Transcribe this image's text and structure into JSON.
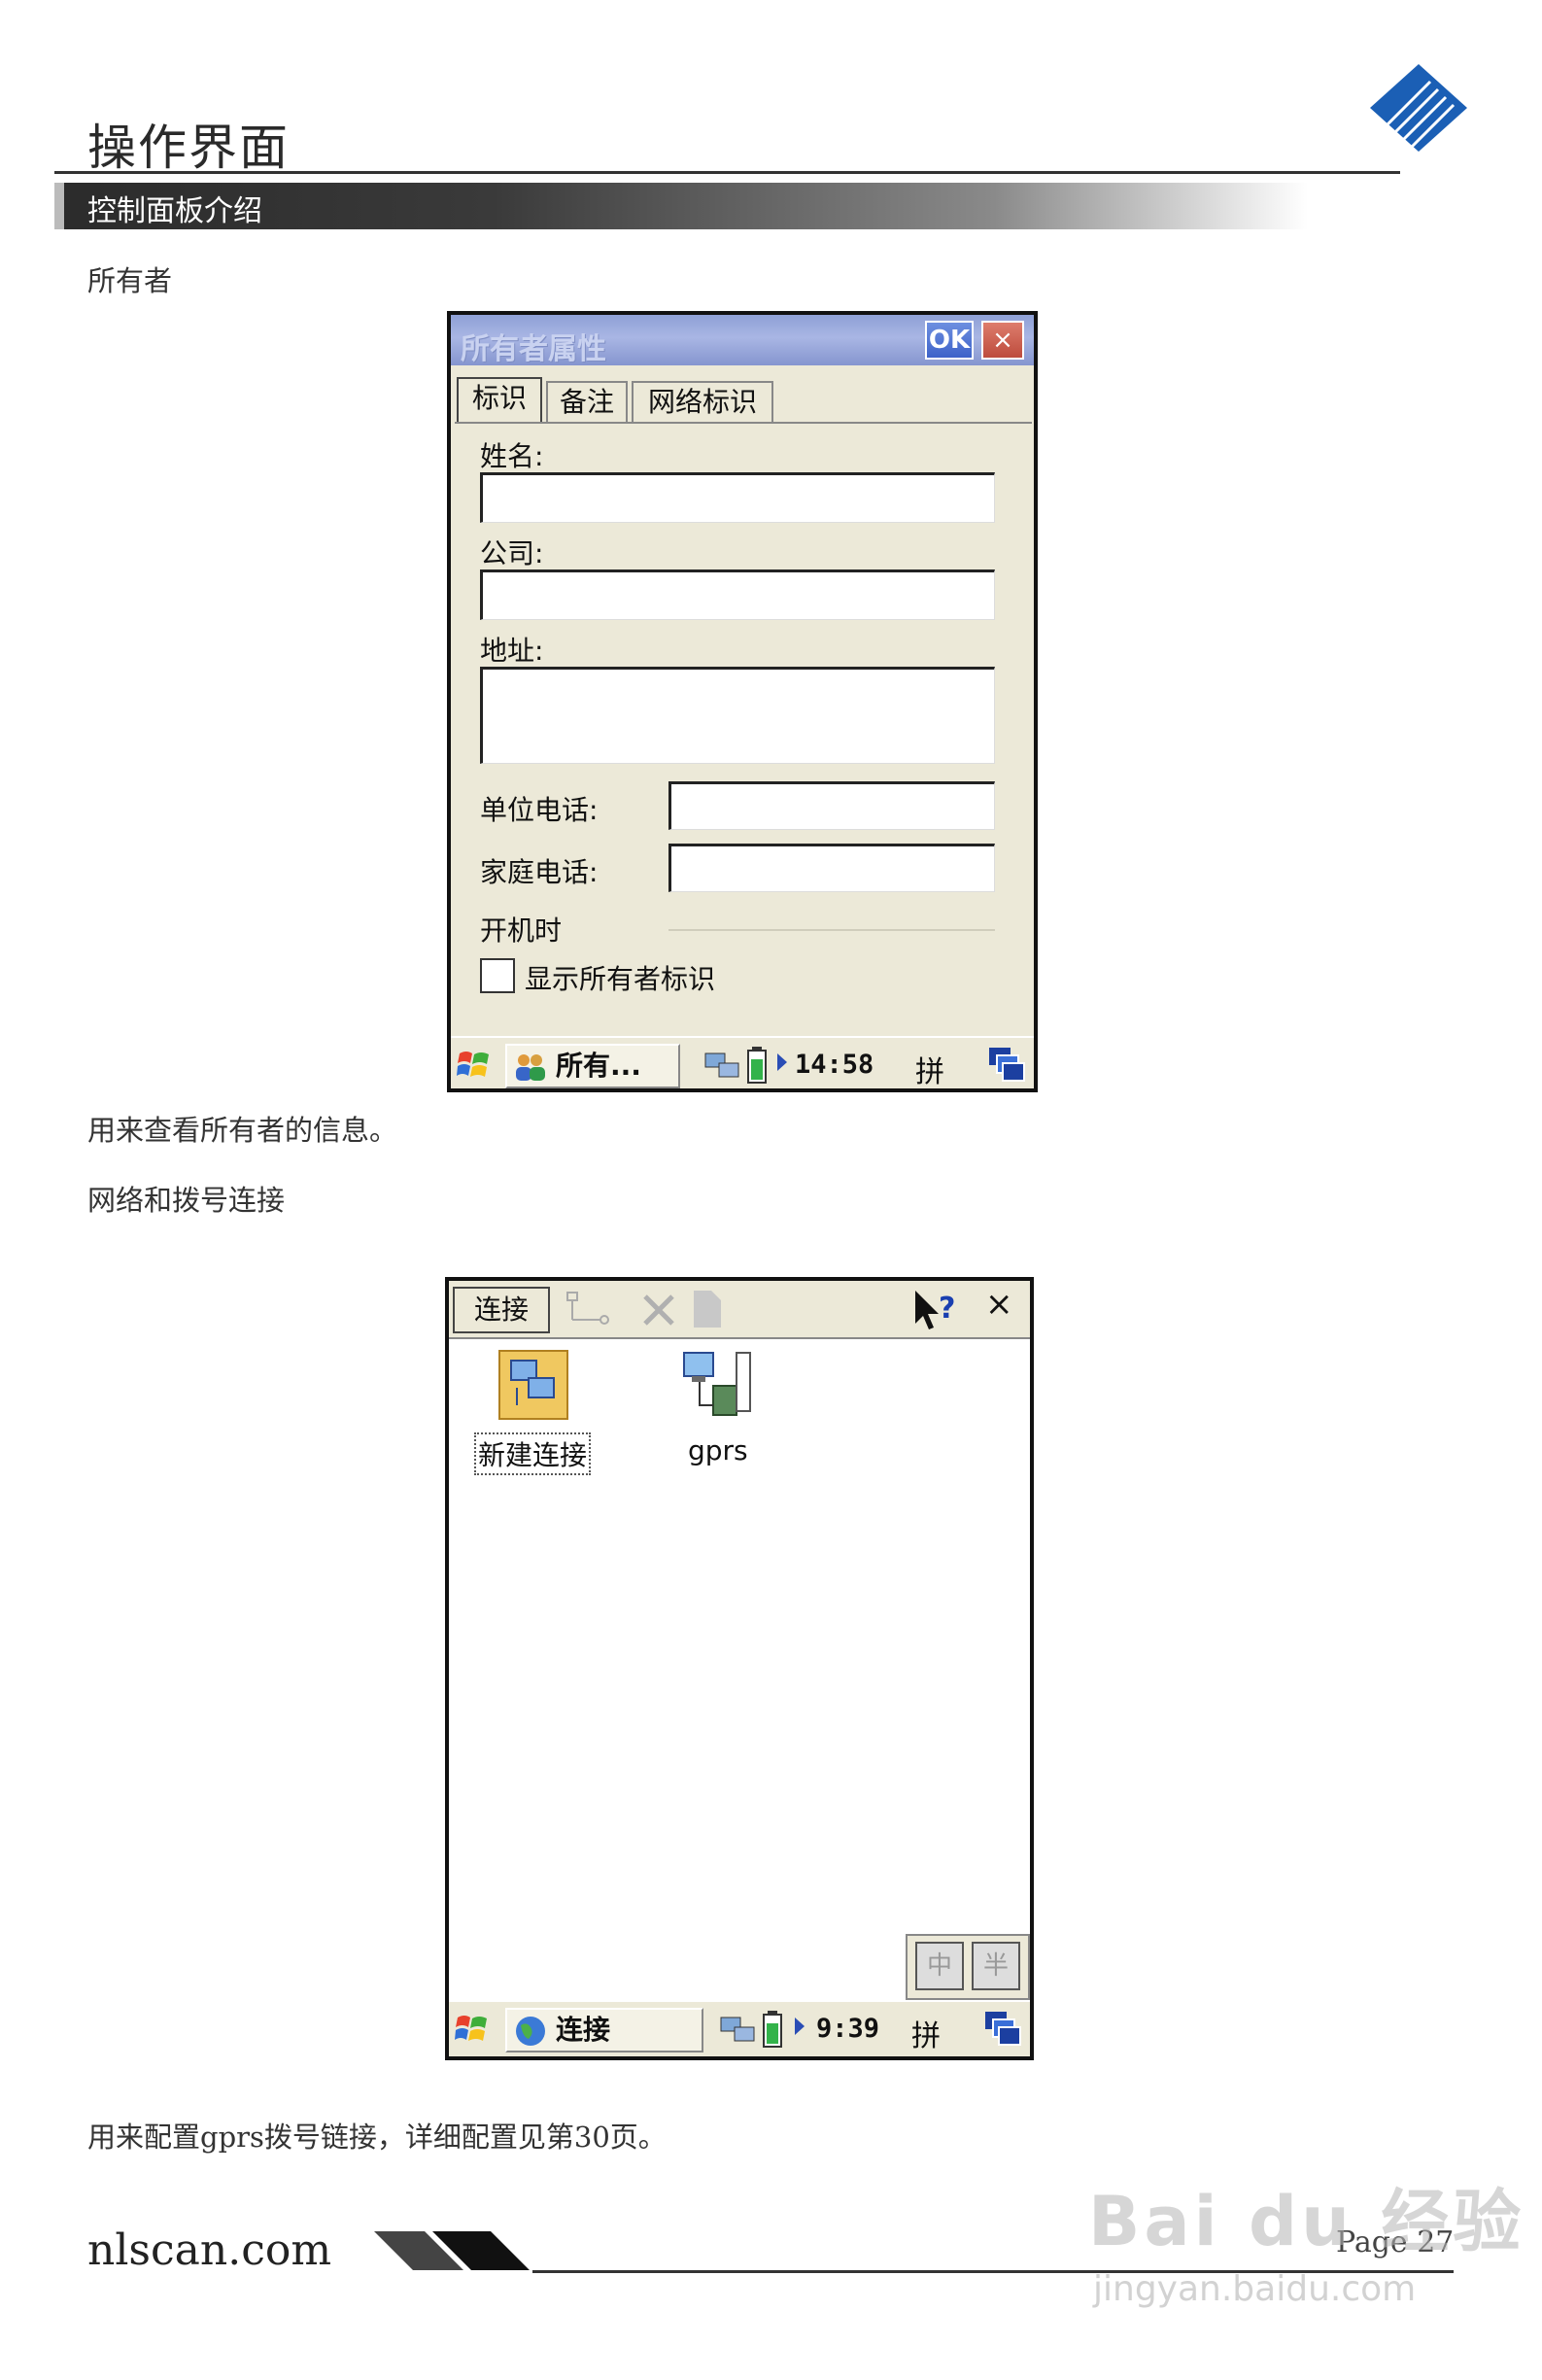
{
  "header": {
    "title": "操作界面",
    "section": "控制面板介绍"
  },
  "owner_section": {
    "heading": "所有者",
    "description": "用来查看所有者的信息。"
  },
  "owner_dialog": {
    "title": "所有者属性",
    "ok_label": "OK",
    "close_label": "×",
    "tabs": [
      {
        "label": "标识",
        "active": true
      },
      {
        "label": "备注",
        "active": false
      },
      {
        "label": "网络标识",
        "active": false
      }
    ],
    "name_label": "姓名:",
    "company_label": "公司:",
    "address_label": "地址:",
    "work_phone_label": "单位电话:",
    "home_phone_label": "家庭电话:",
    "power_on_label": "开机时",
    "show_owner_checkbox": "显示所有者标识",
    "taskbar": {
      "task_label": "所有...",
      "time": "14:58",
      "ime": "拼"
    }
  },
  "network_section": {
    "heading": "网络和拨号连接",
    "description": "用来配置gprs拨号链接，详细配置见第30页。"
  },
  "connection_window": {
    "menu_label": "连接",
    "help_label": "?",
    "close_label": "×",
    "icons": [
      {
        "label": "新建连接",
        "selected": true
      },
      {
        "label": "gprs",
        "selected": false
      }
    ],
    "ime_buttons": [
      "中",
      "半"
    ],
    "taskbar": {
      "task_label": "连接",
      "time": "9:39",
      "ime": "拼"
    }
  },
  "footer": {
    "url": "nlscan.com",
    "page": "Page  27",
    "watermark": "Bai du 经验",
    "watermark_sub": "jingyan.baidu.com"
  },
  "colors": {
    "title_bar": "#8ea0d6",
    "window_bg": "#ece9d8",
    "ok_button": "#3d62c9",
    "close_button": "#bd4b3d",
    "logo": "#1b5fb5"
  }
}
